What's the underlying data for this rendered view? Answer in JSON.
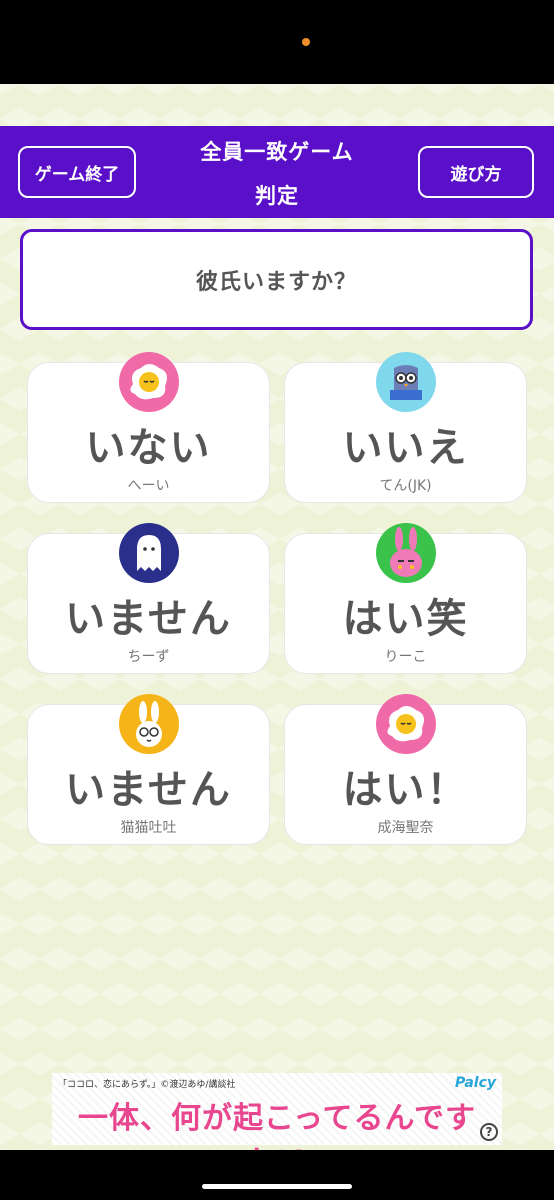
{
  "header": {
    "end_button": "ゲーム終了",
    "help_button": "遊び方",
    "title_line1": "全員一致ゲーム",
    "title_line2": "判定"
  },
  "question": "彼氏いますか？",
  "answers": [
    {
      "answer": "いない",
      "player": "へーい",
      "avatar": "fried-egg-icon",
      "avatar_color": "#f06aa8"
    },
    {
      "answer": "いいえ",
      "player": "てん(JK)",
      "avatar": "owl-on-book-icon",
      "avatar_color": "#7fd8ec"
    },
    {
      "answer": "いません",
      "player": "ちーず",
      "avatar": "ghost-icon",
      "avatar_color": "#2a2f8c"
    },
    {
      "answer": "はい笑",
      "player": "りーこ",
      "avatar": "pink-rabbit-icon",
      "avatar_color": "#3ac24a"
    },
    {
      "answer": "いません",
      "player": "猫猫吐吐",
      "avatar": "white-rabbit-icon",
      "avatar_color": "#f5b519"
    },
    {
      "answer": "はい！",
      "player": "成海聖奈",
      "avatar": "fried-egg-icon",
      "avatar_color": "#f06aa8"
    }
  ],
  "ad": {
    "credit": "「ココロ、恋にあらず。」©渡辺あゆ/講談社",
    "logo": "Palcy",
    "text": "一体、何が起こってるんですか!?",
    "help_glyph": "?"
  },
  "colors": {
    "accent": "#5a0fc8",
    "background": "#eef3d8"
  }
}
